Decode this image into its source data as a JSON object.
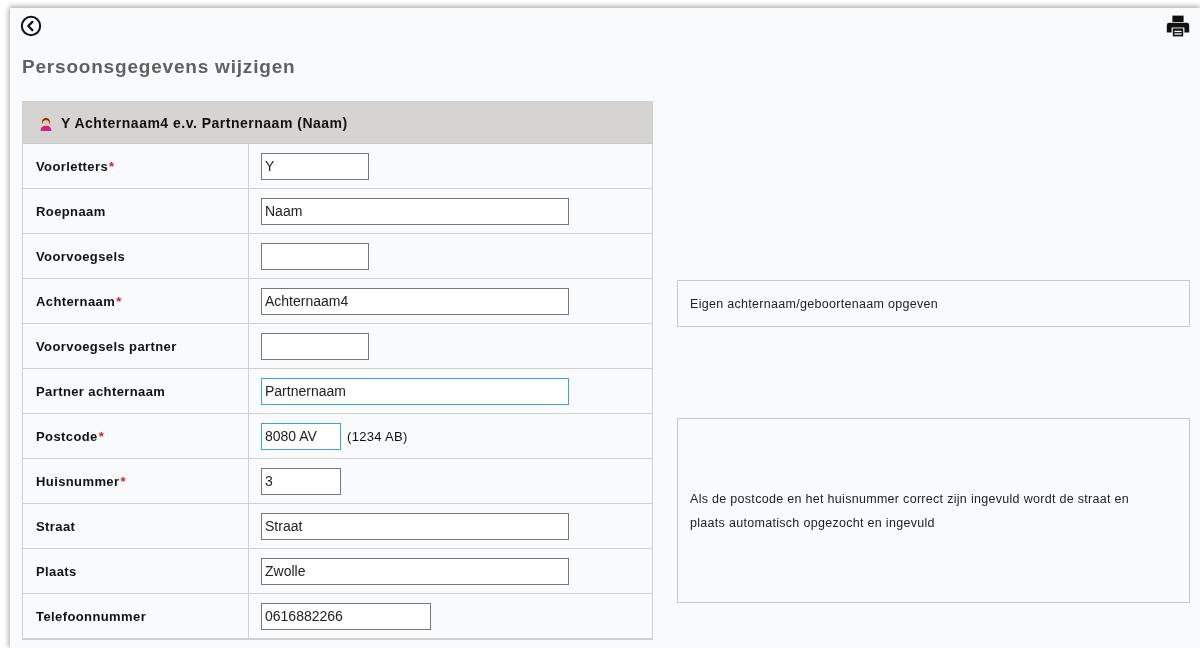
{
  "page_title": "Persoonsgegevens wijzigen",
  "card": {
    "title": "Y Achternaam4 e.v. Partnernaam (Naam)"
  },
  "fields": [
    {
      "label": "Voorletters",
      "marker": "*",
      "value": "Y",
      "kind": "small",
      "highlighted": false
    },
    {
      "label": "Roepnaam",
      "value": "Naam",
      "kind": "wide",
      "highlighted": false
    },
    {
      "label": "Voorvoegsels",
      "kind": "small",
      "highlighted": false
    },
    {
      "label": "Achternaam",
      "marker": "*",
      "value": "Achternaam4",
      "kind": "wide",
      "highlighted": false
    },
    {
      "label": "Voorvoegsels partner",
      "kind": "small",
      "highlighted": false
    },
    {
      "label": "Partner achternaam",
      "value": "Partnernaam",
      "kind": "wide",
      "highlighted": true
    },
    {
      "label": "Postcode",
      "marker": "*",
      "value": "8080 AV",
      "kind": "short",
      "highlighted": true,
      "hint": "(1234 AB)"
    },
    {
      "label": "Huisnummer",
      "marker": "*",
      "value": "3",
      "kind": "short",
      "highlighted": false
    },
    {
      "label": "Straat",
      "value": "Straat",
      "kind": "wide",
      "highlighted": false
    },
    {
      "label": "Plaats",
      "value": "Zwolle",
      "kind": "wide",
      "highlighted": false
    },
    {
      "label": "Telefoonnummer",
      "value": "0616882266",
      "kind": "medium",
      "highlighted": false
    }
  ],
  "help": [
    "Eigen achternaam/geboortenaam opgeven",
    "Als de postcode en het huisnummer correct zijn ingevuld wordt de straat en plaats automatisch opgezocht en ingevuld"
  ]
}
